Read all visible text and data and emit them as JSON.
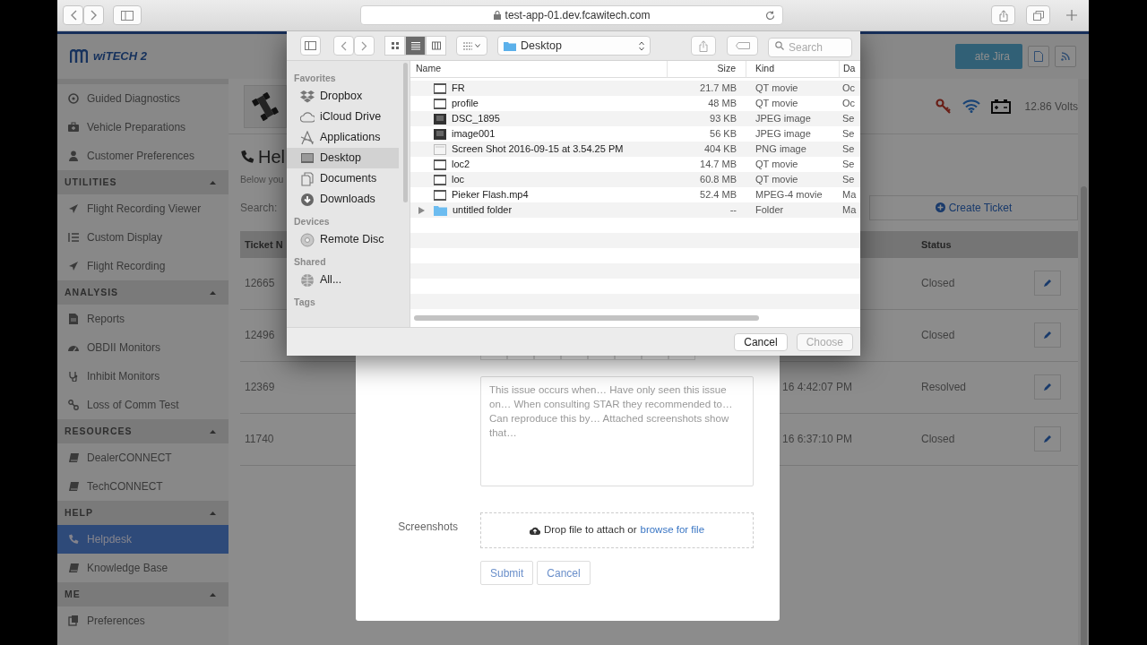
{
  "browser": {
    "url": "test-app-01.dev.fcawitech.com"
  },
  "header": {
    "logo_text": "wiTECH 2",
    "action_button": "ate Jira"
  },
  "status": {
    "voltage": "12.86 Volts"
  },
  "sidebar": [
    {
      "items": [
        {
          "label": "Guided Diagnostics",
          "selected": false
        },
        {
          "label": "Vehicle Preparations",
          "selected": false
        },
        {
          "label": "Customer Preferences",
          "selected": false
        }
      ]
    },
    {
      "title": "UTILITIES",
      "expanded": true,
      "items": [
        {
          "label": "Flight Recording Viewer",
          "selected": false
        },
        {
          "label": "Custom Display",
          "selected": false
        },
        {
          "label": "Flight Recording",
          "selected": false
        }
      ]
    },
    {
      "title": "ANALYSIS",
      "expanded": true,
      "items": [
        {
          "label": "Reports",
          "selected": false
        },
        {
          "label": "OBDII Monitors",
          "selected": false
        },
        {
          "label": "Inhibit Monitors",
          "selected": false
        },
        {
          "label": "Loss of Comm Test",
          "selected": false
        }
      ]
    },
    {
      "title": "RESOURCES",
      "expanded": true,
      "items": [
        {
          "label": "DealerCONNECT",
          "selected": false
        },
        {
          "label": "TechCONNECT",
          "selected": false
        }
      ]
    },
    {
      "title": "HELP",
      "expanded": true,
      "items": [
        {
          "label": "Helpdesk",
          "selected": true
        },
        {
          "label": "Knowledge Base",
          "selected": false
        }
      ]
    },
    {
      "title": "ME",
      "expanded": true,
      "items": [
        {
          "label": "Preferences",
          "selected": false
        }
      ]
    }
  ],
  "page": {
    "heading": "Hel",
    "intro": "Below you",
    "search_label": "Search:",
    "create_button": "Create Ticket"
  },
  "table": {
    "columns": {
      "column_1": "Ticket N",
      "status": "Status"
    },
    "rows": [
      {
        "column_1": "12665",
        "status": "Closed"
      },
      {
        "column_1": "12496",
        "status": "Closed"
      },
      {
        "column_1": "12369",
        "column_2": "16 4:42:07 PM",
        "status": "Resolved"
      },
      {
        "column_1": "11740",
        "column_2": "16 6:37:10 PM",
        "status": "Closed"
      }
    ]
  },
  "modal": {
    "description_placeholder": "This issue occurs when… Have only seen this issue on… When consulting STAR they recommended to… Can reproduce this by… Attached screenshots show that…",
    "screenshots_label": "Screenshots",
    "dropzone_text": "Drop file to attach or",
    "dropzone_link": "browse for file",
    "buttons": [
      "Submit",
      "Cancel"
    ]
  },
  "file_dialog": {
    "view_modes": [
      {
        "selected": false
      },
      {
        "selected": true
      },
      {
        "selected": false
      }
    ],
    "location": "Desktop",
    "search_placeholder": "Search",
    "sidebar": [
      {
        "title": "Favorites",
        "items": [
          {
            "label": "Dropbox",
            "selected": false
          },
          {
            "label": "iCloud Drive",
            "selected": false
          },
          {
            "label": "Applications",
            "selected": false
          },
          {
            "label": "Desktop",
            "selected": true
          },
          {
            "label": "Documents",
            "selected": false
          },
          {
            "label": "Downloads",
            "selected": false
          }
        ]
      },
      {
        "title": "Devices",
        "items": [
          {
            "label": "Remote Disc",
            "selected": false
          }
        ]
      },
      {
        "title": "Shared",
        "items": [
          {
            "label": "All...",
            "selected": false
          }
        ]
      },
      {
        "title": "Tags"
      }
    ],
    "columns": [
      "Name",
      "Size",
      "Kind",
      "Da"
    ],
    "files": [
      {
        "name": "FR",
        "size": "21.7 MB",
        "file_kind": "QT movie",
        "date": "Oc",
        "kind": "movie"
      },
      {
        "name": "profile",
        "size": "48 MB",
        "file_kind": "QT movie",
        "date": "Oc",
        "kind": "movie"
      },
      {
        "name": "DSC_1895",
        "size": "93 KB",
        "file_kind": "JPEG image",
        "date": "Se",
        "kind": "photo"
      },
      {
        "name": "image001",
        "size": "56 KB",
        "file_kind": "JPEG image",
        "date": "Se",
        "kind": "photo"
      },
      {
        "name": "Screen Shot 2016-09-15 at 3.54.25 PM",
        "size": "404 KB",
        "file_kind": "PNG image",
        "date": "Se",
        "kind": "screenshot"
      },
      {
        "name": "loc2",
        "size": "14.7 MB",
        "file_kind": "QT movie",
        "date": "Se",
        "kind": "movie"
      },
      {
        "name": "loc",
        "size": "60.8 MB",
        "file_kind": "QT movie",
        "date": "Se",
        "kind": "movie"
      },
      {
        "name": "Pieker Flash.mp4",
        "size": "52.4 MB",
        "file_kind": "MPEG-4 movie",
        "date": "Ma",
        "kind": "movie"
      },
      {
        "name": "untitled folder",
        "size": "--",
        "file_kind": "Folder",
        "date": "Ma",
        "kind": "folder"
      }
    ],
    "cancel": "Cancel",
    "choose": {
      "label": "Choose",
      "disabled": true
    }
  }
}
